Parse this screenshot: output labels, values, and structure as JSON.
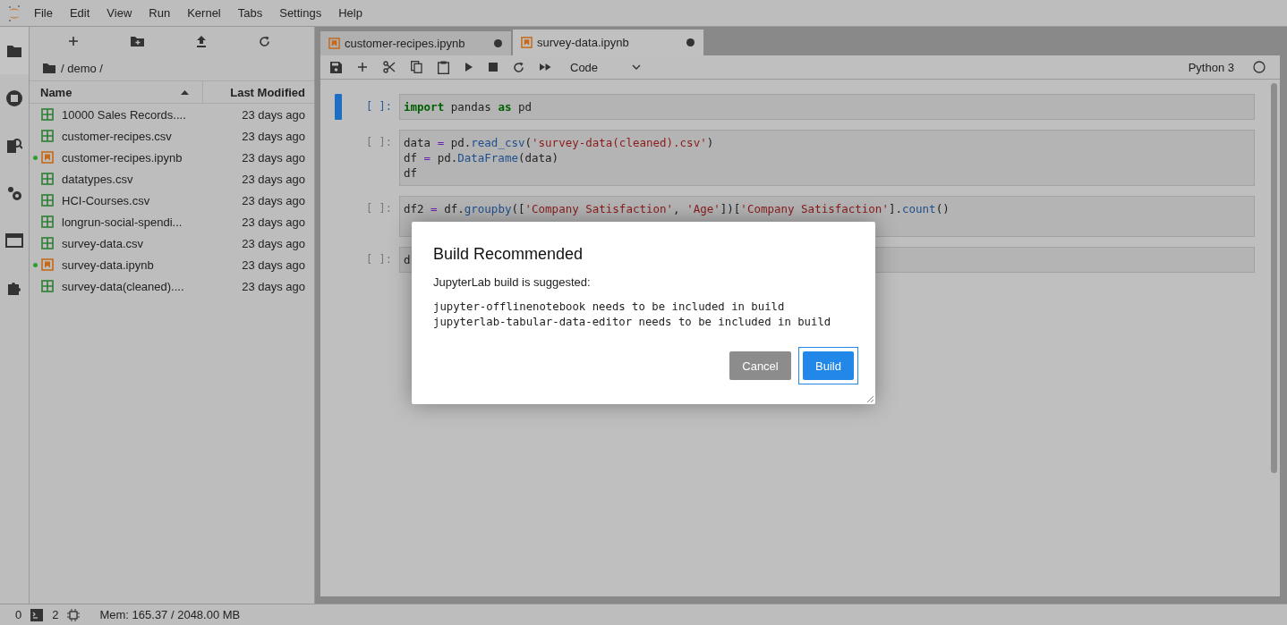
{
  "menu": [
    "File",
    "Edit",
    "View",
    "Run",
    "Kernel",
    "Tabs",
    "Settings",
    "Help"
  ],
  "file_browser": {
    "breadcrumb": "/ demo /",
    "columns": [
      "Name",
      "Last Modified"
    ],
    "files": [
      {
        "name": "10000 Sales Records....",
        "modified": "23 days ago",
        "kind": "csv",
        "running": false
      },
      {
        "name": "customer-recipes.csv",
        "modified": "23 days ago",
        "kind": "csv",
        "running": false
      },
      {
        "name": "customer-recipes.ipynb",
        "modified": "23 days ago",
        "kind": "notebook",
        "running": true
      },
      {
        "name": "datatypes.csv",
        "modified": "23 days ago",
        "kind": "csv",
        "running": false
      },
      {
        "name": "HCI-Courses.csv",
        "modified": "23 days ago",
        "kind": "csv",
        "running": false
      },
      {
        "name": "longrun-social-spendi...",
        "modified": "23 days ago",
        "kind": "csv",
        "running": false
      },
      {
        "name": "survey-data.csv",
        "modified": "23 days ago",
        "kind": "csv",
        "running": false
      },
      {
        "name": "survey-data.ipynb",
        "modified": "23 days ago",
        "kind": "notebook",
        "running": true
      },
      {
        "name": "survey-data(cleaned)....",
        "modified": "23 days ago",
        "kind": "csv",
        "running": false
      }
    ]
  },
  "tabs": [
    {
      "label": "customer-recipes.ipynb",
      "selected": false,
      "unsaved": true
    },
    {
      "label": "survey-data.ipynb",
      "selected": true,
      "unsaved": true
    }
  ],
  "toolbar": {
    "cell_type": "Code",
    "kernel": "Python 3"
  },
  "cells": [
    {
      "prompt": "[ ]:",
      "active": true,
      "lines": [
        [
          {
            "kind": "keyword",
            "text": "import"
          },
          {
            "kind": "plain",
            "text": " pandas "
          },
          {
            "kind": "keyword",
            "text": "as"
          },
          {
            "kind": "plain",
            "text": " pd"
          }
        ]
      ]
    },
    {
      "prompt": "[ ]:",
      "active": false,
      "lines": [
        [
          {
            "kind": "plain",
            "text": "data "
          },
          {
            "kind": "op",
            "text": "="
          },
          {
            "kind": "plain",
            "text": " pd."
          },
          {
            "kind": "func",
            "text": "read_csv"
          },
          {
            "kind": "plain",
            "text": "("
          },
          {
            "kind": "string",
            "text": "'survey-data(cleaned).csv'"
          },
          {
            "kind": "plain",
            "text": ")"
          }
        ],
        [
          {
            "kind": "plain",
            "text": "df "
          },
          {
            "kind": "op",
            "text": "="
          },
          {
            "kind": "plain",
            "text": " pd."
          },
          {
            "kind": "func",
            "text": "DataFrame"
          },
          {
            "kind": "plain",
            "text": "(data)"
          }
        ],
        [
          {
            "kind": "plain",
            "text": "df"
          }
        ]
      ]
    },
    {
      "prompt": "[ ]:",
      "active": false,
      "lines": [
        [
          {
            "kind": "plain",
            "text": "df2 "
          },
          {
            "kind": "op",
            "text": "="
          },
          {
            "kind": "plain",
            "text": " df."
          },
          {
            "kind": "func",
            "text": "groupby"
          },
          {
            "kind": "plain",
            "text": "(["
          },
          {
            "kind": "string",
            "text": "'Company Satisfaction'"
          },
          {
            "kind": "plain",
            "text": ", "
          },
          {
            "kind": "string",
            "text": "'Age'"
          },
          {
            "kind": "plain",
            "text": "])["
          },
          {
            "kind": "string",
            "text": "'Company Satisfaction'"
          },
          {
            "kind": "plain",
            "text": "]."
          },
          {
            "kind": "func",
            "text": "count"
          },
          {
            "kind": "plain",
            "text": "()"
          }
        ]
      ]
    },
    {
      "prompt": "[ ]:",
      "active": false,
      "lines": [
        [
          {
            "kind": "plain",
            "text": "d"
          }
        ]
      ]
    }
  ],
  "dialog": {
    "title": "Build Recommended",
    "body": "JupyterLab build is suggested:",
    "messages": [
      "jupyter-offlinenotebook needs to be included in build",
      "jupyterlab-tabular-data-editor needs to be included in build"
    ],
    "buttons": [
      {
        "label": "Cancel",
        "kind": "reject"
      },
      {
        "label": "Build",
        "kind": "accept"
      }
    ]
  },
  "status_bar": {
    "terminals": "0",
    "kernels": "2",
    "memory": "Mem: 165.37 / 2048.00 MB"
  }
}
